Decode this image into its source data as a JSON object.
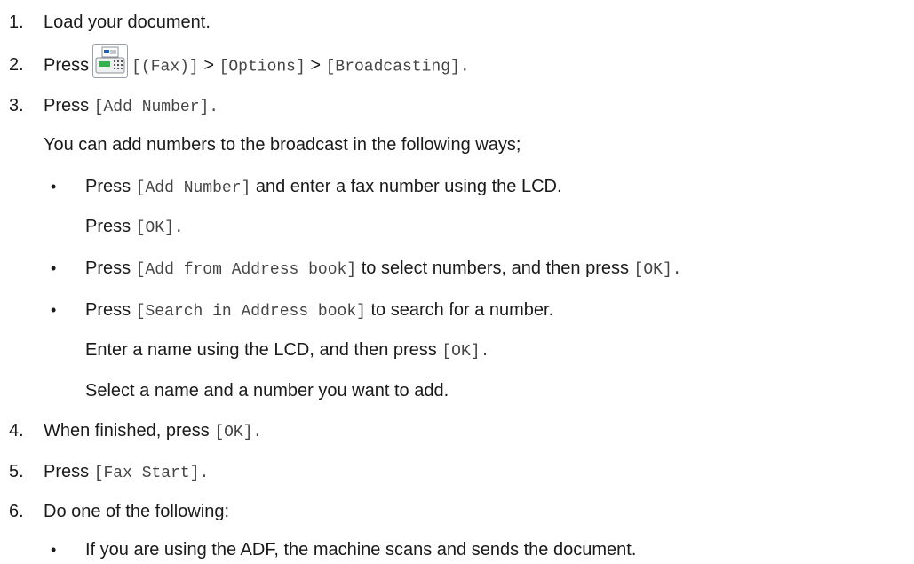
{
  "steps": [
    {
      "num": "1.",
      "text": "Load your document."
    },
    {
      "num": "2.",
      "press": "Press",
      "fax": "[(Fax)]",
      "sep1": ">",
      "options": "[Options]",
      "sep2": ">",
      "broadcasting": "[Broadcasting]."
    },
    {
      "num": "3.",
      "press": "Press",
      "code": "[Add Number]."
    },
    {
      "num": "4.",
      "text": "When finished, press",
      "code": "[OK]."
    },
    {
      "num": "5.",
      "press": "Press",
      "code": "[Fax Start]."
    },
    {
      "num": "6.",
      "text": "Do one of the following:"
    }
  ],
  "step3_note": "You can add numbers to the broadcast in the following ways;",
  "bullets": {
    "b1": {
      "press": "Press",
      "code": "[Add Number]",
      "rest": "and enter a fax number using the LCD."
    },
    "b1_line2": {
      "press": "Press",
      "code": "[OK]."
    },
    "b2": {
      "press": "Press",
      "code": "[Add from Address book]",
      "rest": "to select numbers, and then press",
      "code2": "[OK]."
    },
    "b3": {
      "press": "Press",
      "code": "[Search in Address book]",
      "rest": "to search for a number."
    },
    "b3_line2": {
      "text": "Enter a name using the LCD, and then press",
      "code": "[OK]."
    },
    "b3_line3": {
      "text": "Select a name and a number you want to add."
    },
    "b6": {
      "text": "If you are using the ADF, the machine scans and sends the document."
    }
  },
  "bullet_char": "•",
  "icon": "fax-icon"
}
